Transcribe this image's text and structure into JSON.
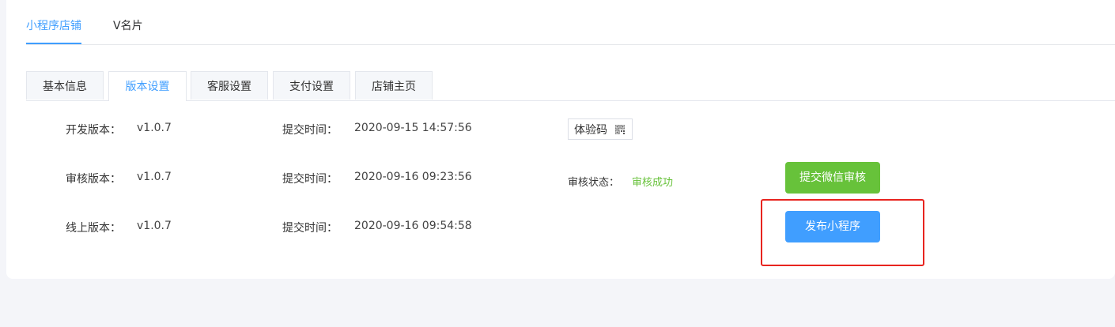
{
  "top_tabs": [
    {
      "label": "小程序店铺",
      "active": true
    },
    {
      "label": "V名片",
      "active": false
    }
  ],
  "sub_tabs": [
    {
      "label": "基本信息",
      "active": false
    },
    {
      "label": "版本设置",
      "active": true
    },
    {
      "label": "客服设置",
      "active": false
    },
    {
      "label": "支付设置",
      "active": false
    },
    {
      "label": "店铺主页",
      "active": false
    }
  ],
  "versions": {
    "dev": {
      "label": "开发版本：",
      "version": "v1.0.7",
      "time_label": "提交时间：",
      "time": "2020-09-15 14:57:56"
    },
    "audit": {
      "label": "审核版本：",
      "version": "v1.0.7",
      "time_label": "提交时间：",
      "time": "2020-09-16 09:23:56"
    },
    "online": {
      "label": "线上版本：",
      "version": "v1.0.7",
      "time_label": "提交时间：",
      "time": "2020-09-16 09:54:58"
    }
  },
  "experience_code": {
    "label": "体验码",
    "icon": "qr-code-icon"
  },
  "audit_status": {
    "label": "审核状态：",
    "value": "审核成功",
    "color": "#67c23a"
  },
  "buttons": {
    "submit_audit": {
      "label": "提交微信审核",
      "color": "#67c23a"
    },
    "publish": {
      "label": "发布小程序",
      "color": "#409eff"
    }
  },
  "colors": {
    "accent": "#409eff",
    "highlight": "#e8241f"
  }
}
